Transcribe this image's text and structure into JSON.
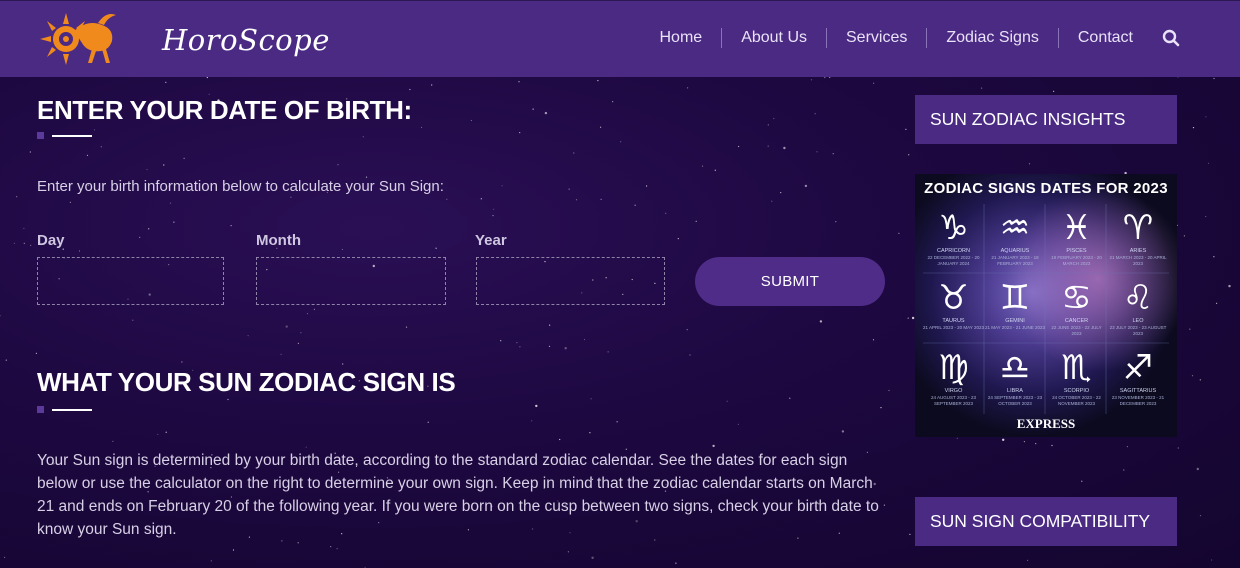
{
  "brand": {
    "name": "HoroScope",
    "logo_icon": "sun-capricorn-icon"
  },
  "nav": {
    "items": [
      "Home",
      "About Us",
      "Services",
      "Zodiac Signs",
      "Contact"
    ],
    "search_icon": "search-icon"
  },
  "birth_form": {
    "title": "ENTER YOUR DATE OF BIRTH:",
    "intro": "Enter your birth information below to calculate your Sun Sign:",
    "day_label": "Day",
    "month_label": "Month",
    "year_label": "Year",
    "day_value": "",
    "month_value": "",
    "year_value": "",
    "submit_label": "SUBMIT"
  },
  "sun_sign": {
    "title": "WHAT YOUR SUN ZODIAC SIGN IS",
    "body": "Your Sun sign is determined by your birth date, according to the standard zodiac calendar. See the dates for each sign below or use the calculator on the right to determine your own sign. Keep in mind that the zodiac calendar starts on March 21 and ends on February 20 of the following year. If you were born on the cusp between two signs, check your birth date to know your Sun sign."
  },
  "sidebar": {
    "insights_title": "SUN ZODIAC INSIGHTS",
    "compat_title": "SUN SIGN COMPATIBILITY",
    "card": {
      "title": "ZODIAC SIGNS DATES FOR 2023",
      "source": "EXPRESS",
      "signs": [
        {
          "glyph": "♑",
          "name": "CAPRICORN",
          "dates": "22 DECEMBER 2022 - 20 JANUARY 2024"
        },
        {
          "glyph": "♒",
          "name": "AQUARIUS",
          "dates": "21 JANUARY 2023 - 18 FEBRUARY 2023"
        },
        {
          "glyph": "♓",
          "name": "PISCES",
          "dates": "19 FEBRUARY 2023 - 20 MARCH 2023"
        },
        {
          "glyph": "♈",
          "name": "ARIES",
          "dates": "21 MARCH 2023 - 20 APRIL 2023"
        },
        {
          "glyph": "♉",
          "name": "TAURUS",
          "dates": "21 APRIL 2023 - 20 MAY 2023"
        },
        {
          "glyph": "♊",
          "name": "GEMINI",
          "dates": "21 MAY 2023 - 21 JUNE 2023"
        },
        {
          "glyph": "♋",
          "name": "CANCER",
          "dates": "22 JUNE 2023 - 22 JULY 2023"
        },
        {
          "glyph": "♌",
          "name": "LEO",
          "dates": "23 JULY 2023 - 23 AUGUST 2023"
        },
        {
          "glyph": "♍",
          "name": "VIRGO",
          "dates": "24 AUGUST 2023 - 23 SEPTEMBER 2023"
        },
        {
          "glyph": "♎",
          "name": "LIBRA",
          "dates": "24 SEPTEMBER 2023 - 23 OCTOBER 2023"
        },
        {
          "glyph": "♏",
          "name": "SCORPIO",
          "dates": "24 OCTOBER 2023 - 22 NOVEMBER 2023"
        },
        {
          "glyph": "♐",
          "name": "SAGITTARIUS",
          "dates": "23 NOVEMBER 2023 - 21 DECEMBER 2023"
        }
      ]
    }
  },
  "colors": {
    "nav_bg": "#4b2a84",
    "page_bg": "#1d0840",
    "button_bg": "#4e2c88",
    "logo_orange": "#f08a1c"
  }
}
